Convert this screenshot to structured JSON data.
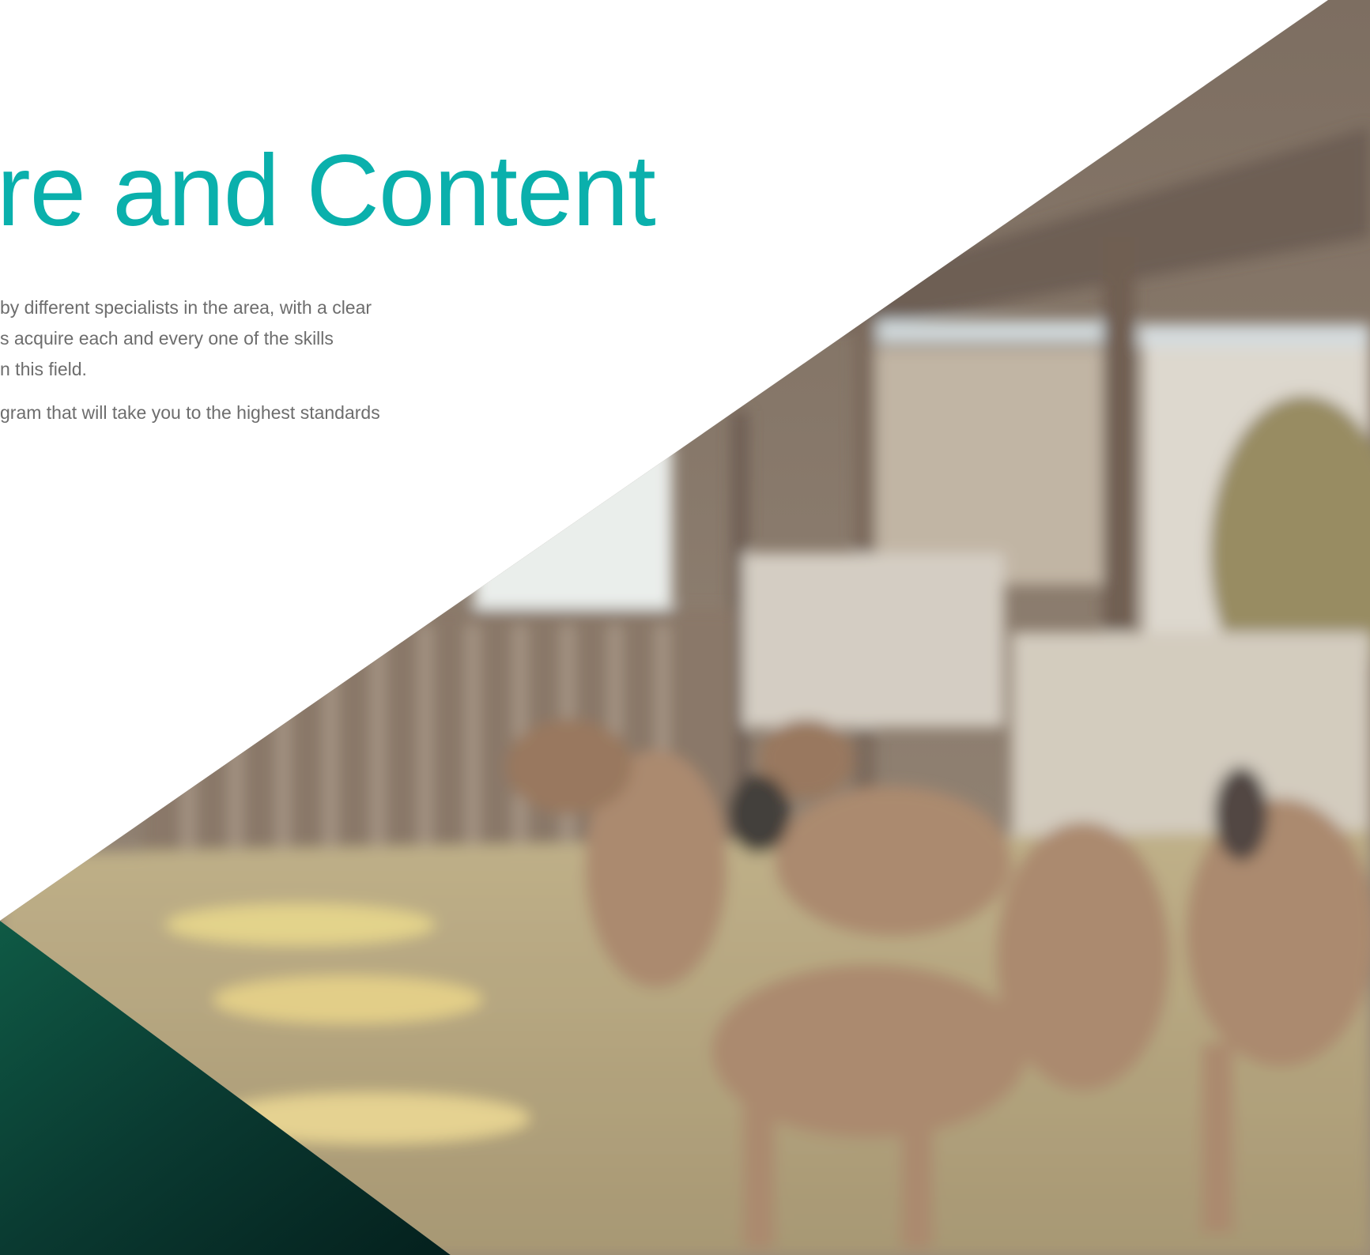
{
  "hero": {
    "headline": "re and Content",
    "paragraph_1_lines": [
      "by different specialists in the area, with a clear",
      "s acquire each and every one of the skills",
      "n this field."
    ],
    "paragraph_2_lines": [
      "gram that will take you to the highest standards"
    ]
  },
  "colors": {
    "accent": "#0ab0ac",
    "body_text": "#6d6d6d",
    "background": "#ffffff",
    "dark_green_corner": "#0b3b30"
  },
  "images": {
    "hero_photo": "goats-in-barn-photo"
  }
}
